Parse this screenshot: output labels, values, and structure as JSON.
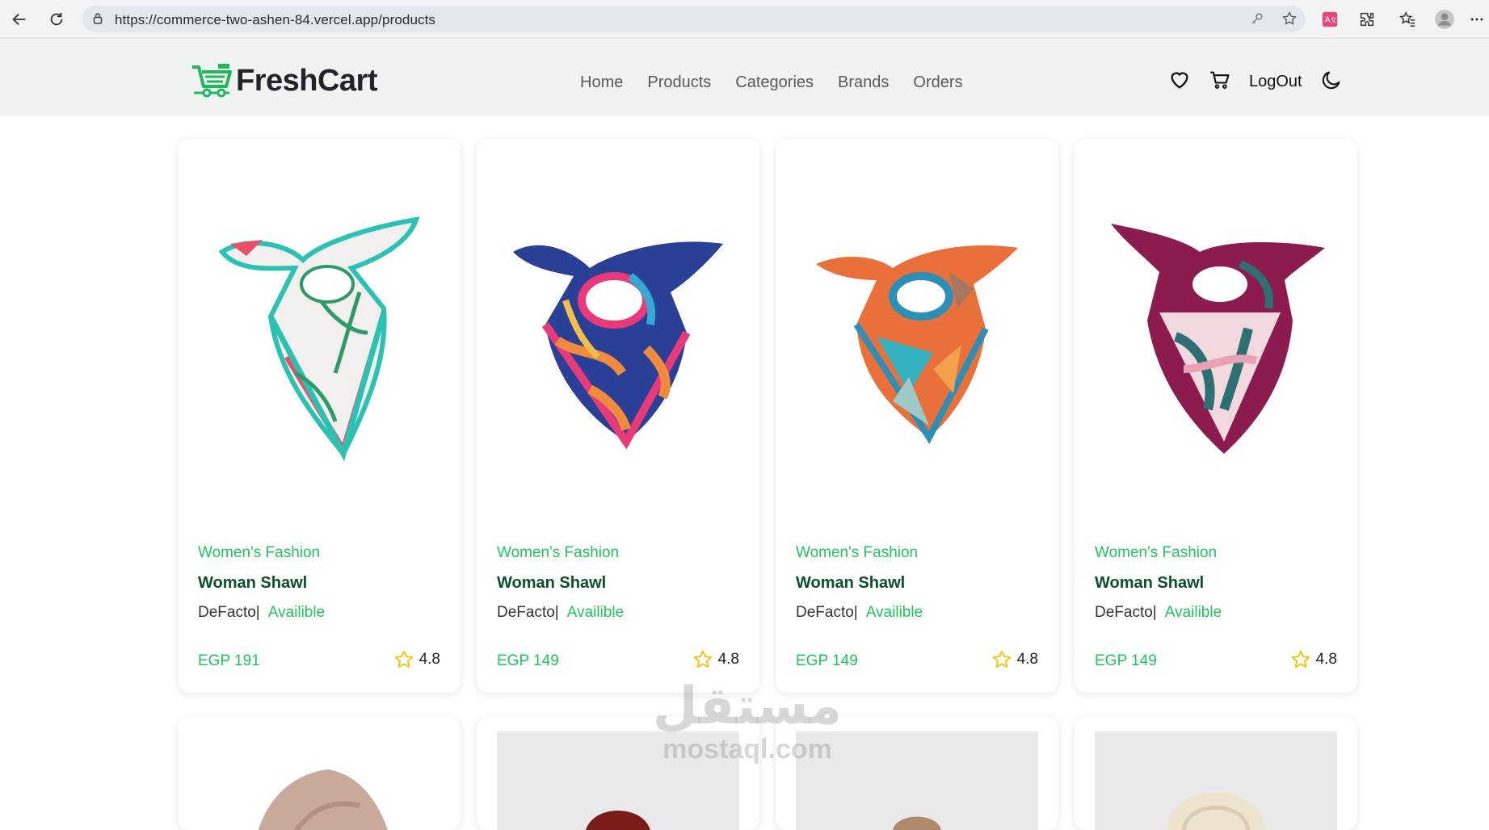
{
  "browser": {
    "url": "https://commerce-two-ashen-84.vercel.app/products"
  },
  "navbar": {
    "brand": "FreshCart",
    "links": [
      "Home",
      "Products",
      "Categories",
      "Brands",
      "Orders"
    ],
    "logout": "LogOut"
  },
  "products": [
    {
      "category": "Women's Fashion",
      "title": "Woman Shawl",
      "brand": "DeFacto|",
      "status": "Availible",
      "price": "EGP 191",
      "rating": "4.8"
    },
    {
      "category": "Women's Fashion",
      "title": "Woman Shawl",
      "brand": "DeFacto|",
      "status": "Availible",
      "price": "EGP 149",
      "rating": "4.8"
    },
    {
      "category": "Women's Fashion",
      "title": "Woman Shawl",
      "brand": "DeFacto|",
      "status": "Availible",
      "price": "EGP 149",
      "rating": "4.8"
    },
    {
      "category": "Women's Fashion",
      "title": "Woman Shawl",
      "brand": "DeFacto|",
      "status": "Availible",
      "price": "EGP 149",
      "rating": "4.8"
    }
  ],
  "watermark": {
    "arabic": "مستقل",
    "latin": "mostaql.com"
  },
  "colors": {
    "accent": "#22c35e",
    "title": "#0b4f2c",
    "navbar_bg": "#f0f3f2"
  }
}
